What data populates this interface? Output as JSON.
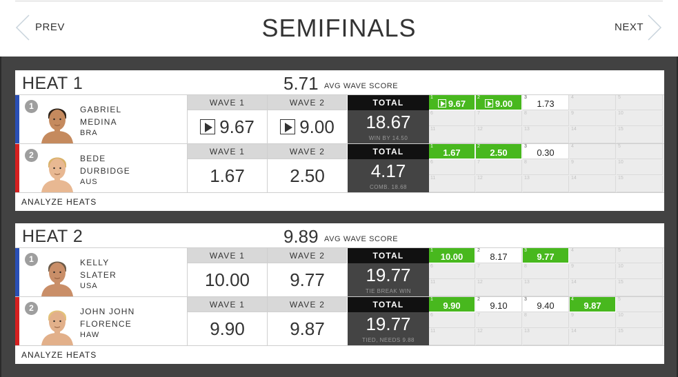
{
  "header": {
    "prev_label": "PREV",
    "next_label": "NEXT",
    "title": "SEMIFINALS"
  },
  "heats": [
    {
      "title": "HEAT 1",
      "avg_value": "5.71",
      "avg_label": "AVG WAVE SCORE",
      "analyze_label": "ANALYZE HEATS",
      "surfers": [
        {
          "seed": "1",
          "first": "GABRIEL",
          "last": "MEDINA",
          "country": "BRA",
          "color": "#2a4fb5",
          "wave1_label": "WAVE 1",
          "wave2_label": "WAVE 2",
          "wave1": "9.67",
          "wave2": "9.00",
          "total_label": "TOTAL",
          "total": "18.67",
          "total_note": "WIN BY 14.50",
          "scores": [
            {
              "n": "1",
              "v": "9.67",
              "style": "green",
              "video": true
            },
            {
              "n": "2",
              "v": "9.00",
              "style": "green",
              "video": true
            },
            {
              "n": "3",
              "v": "1.73",
              "style": "white"
            },
            {
              "n": "4",
              "v": ""
            },
            {
              "n": "5",
              "v": ""
            },
            {
              "n": "6",
              "v": ""
            },
            {
              "n": "7",
              "v": ""
            },
            {
              "n": "8",
              "v": ""
            },
            {
              "n": "9",
              "v": ""
            },
            {
              "n": "10",
              "v": ""
            },
            {
              "n": "11",
              "v": ""
            },
            {
              "n": "12",
              "v": ""
            },
            {
              "n": "13",
              "v": ""
            },
            {
              "n": "14",
              "v": ""
            },
            {
              "n": "15",
              "v": ""
            }
          ]
        },
        {
          "seed": "2",
          "first": "BEDE",
          "last": "DURBIDGE",
          "country": "AUS",
          "color": "#d62020",
          "wave1_label": "WAVE 1",
          "wave2_label": "WAVE 2",
          "wave1": "1.67",
          "wave2": "2.50",
          "total_label": "TOTAL",
          "total": "4.17",
          "total_note": "COMB. 18.68",
          "scores": [
            {
              "n": "1",
              "v": "1.67",
              "style": "green"
            },
            {
              "n": "2",
              "v": "2.50",
              "style": "green"
            },
            {
              "n": "3",
              "v": "0.30",
              "style": "white"
            },
            {
              "n": "4",
              "v": ""
            },
            {
              "n": "5",
              "v": ""
            },
            {
              "n": "6",
              "v": ""
            },
            {
              "n": "7",
              "v": ""
            },
            {
              "n": "8",
              "v": ""
            },
            {
              "n": "9",
              "v": ""
            },
            {
              "n": "10",
              "v": ""
            },
            {
              "n": "11",
              "v": ""
            },
            {
              "n": "12",
              "v": ""
            },
            {
              "n": "13",
              "v": ""
            },
            {
              "n": "14",
              "v": ""
            },
            {
              "n": "15",
              "v": ""
            }
          ]
        }
      ]
    },
    {
      "title": "HEAT 2",
      "avg_value": "9.89",
      "avg_label": "AVG WAVE SCORE",
      "analyze_label": "ANALYZE HEATS",
      "surfers": [
        {
          "seed": "1",
          "first": "KELLY",
          "last": "SLATER",
          "country": "USA",
          "color": "#2a4fb5",
          "wave1_label": "WAVE 1",
          "wave2_label": "WAVE 2",
          "wave1": "10.00",
          "wave2": "9.77",
          "total_label": "TOTAL",
          "total": "19.77",
          "total_note": "TIE BREAK WIN",
          "scores": [
            {
              "n": "1",
              "v": "10.00",
              "style": "green"
            },
            {
              "n": "2",
              "v": "8.17",
              "style": "white"
            },
            {
              "n": "3",
              "v": "9.77",
              "style": "green"
            },
            {
              "n": "4",
              "v": ""
            },
            {
              "n": "5",
              "v": ""
            },
            {
              "n": "6",
              "v": ""
            },
            {
              "n": "7",
              "v": ""
            },
            {
              "n": "8",
              "v": ""
            },
            {
              "n": "9",
              "v": ""
            },
            {
              "n": "10",
              "v": ""
            },
            {
              "n": "11",
              "v": ""
            },
            {
              "n": "12",
              "v": ""
            },
            {
              "n": "13",
              "v": ""
            },
            {
              "n": "14",
              "v": ""
            },
            {
              "n": "15",
              "v": ""
            }
          ]
        },
        {
          "seed": "2",
          "first": "JOHN JOHN",
          "last": "FLORENCE",
          "country": "HAW",
          "color": "#d62020",
          "wave1_label": "WAVE 1",
          "wave2_label": "WAVE 2",
          "wave1": "9.90",
          "wave2": "9.87",
          "total_label": "TOTAL",
          "total": "19.77",
          "total_note": "TIED, NEEDS 9.88",
          "scores": [
            {
              "n": "1",
              "v": "9.90",
              "style": "green"
            },
            {
              "n": "2",
              "v": "9.10",
              "style": "white"
            },
            {
              "n": "3",
              "v": "9.40",
              "style": "white"
            },
            {
              "n": "4",
              "v": "9.87",
              "style": "green"
            },
            {
              "n": "5",
              "v": ""
            },
            {
              "n": "6",
              "v": ""
            },
            {
              "n": "7",
              "v": ""
            },
            {
              "n": "8",
              "v": ""
            },
            {
              "n": "9",
              "v": ""
            },
            {
              "n": "10",
              "v": ""
            },
            {
              "n": "11",
              "v": ""
            },
            {
              "n": "12",
              "v": ""
            },
            {
              "n": "13",
              "v": ""
            },
            {
              "n": "14",
              "v": ""
            },
            {
              "n": "15",
              "v": ""
            }
          ]
        }
      ]
    }
  ],
  "icons": {
    "prev": "chevron-left-icon",
    "next": "chevron-right-icon",
    "video": "play-icon",
    "avatar": "surfer-avatar"
  },
  "colors": {
    "score_highlight": "#48b81e",
    "total_header": "#111111",
    "total_bg": "#444444",
    "content_bg": "#424242"
  }
}
